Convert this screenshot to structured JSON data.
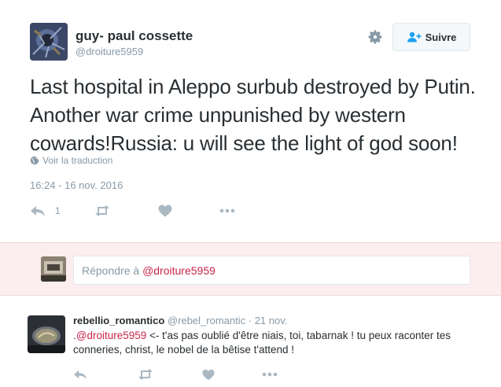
{
  "tweet": {
    "fullname": "guy- paul cossette",
    "screen_name": "@droiture5959",
    "follow_label": "Suivre",
    "text": "Last hospital in Aleppo surbub destroyed by Putin. Another war crime unpunished by western cowards!Russia: u will see the light of god soon!",
    "translate_label": "Voir la traduction",
    "timestamp": "16:24 - 16 nov. 2016",
    "reply_count": "1",
    "icons": {
      "settings": "gear-icon",
      "follow": "add-user-icon",
      "translate": "globe-icon",
      "reply": "reply-icon",
      "retweet": "retweet-icon",
      "like": "heart-icon",
      "more": "more-icon"
    }
  },
  "reply_box": {
    "prefix": "Répondre à ",
    "mention": "@droiture5959"
  },
  "reply_tweet": {
    "fullname": "rebellio_romantico",
    "screen_name": "@rebel_romantic",
    "separator": " · ",
    "date": "21 nov.",
    "text_prefix": ".",
    "mention": "@droiture5959",
    "text": " <- t'as pas oublié d'être niais, toi, tabarnak ! tu peux raconter tes conneries, christ, le nobel de la bêtise t'attend !"
  },
  "colors": {
    "accent_mention": "#c9254b",
    "reply_box_bg": "#fcedef",
    "muted": "#8899a6",
    "text": "#292f33"
  }
}
